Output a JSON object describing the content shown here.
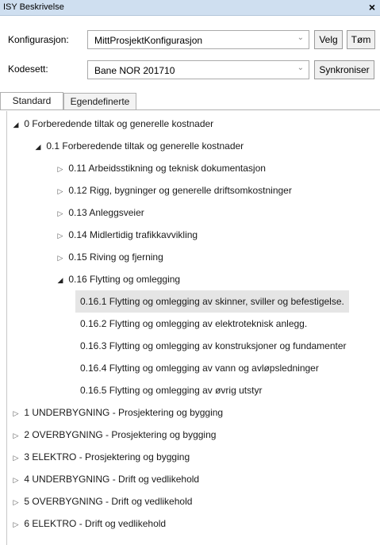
{
  "window": {
    "title": "ISY Beskrivelse",
    "close": "×"
  },
  "config": {
    "konfig_label": "Konfigurasjon:",
    "konfig_value": "MittProsjektKonfigurasjon",
    "velg": "Velg",
    "tom": "Tøm",
    "kodesett_label": "Kodesett:",
    "kodesett_value": "Bane NOR 201710",
    "synk": "Synkroniser"
  },
  "tabs": {
    "standard": "Standard",
    "egendefinerte": "Egendefinerte"
  },
  "icons": {
    "collapsed": "▷",
    "expanded": "◢",
    "dropdown": "⌄"
  },
  "tree": [
    {
      "text": "0 Forberedende tiltak og generelle kostnader",
      "expanded": true
    },
    {
      "text": "0.1  Forberedende tiltak og generelle kostnader",
      "expanded": true
    },
    {
      "text": "0.11  Arbeidsstikning og teknisk dokumentasjon",
      "expanded": false
    },
    {
      "text": "0.12  Rigg, bygninger og generelle driftsomkostninger",
      "expanded": false
    },
    {
      "text": "0.13  Anleggsveier",
      "expanded": false
    },
    {
      "text": "0.14  Midlertidig trafikkavvikling",
      "expanded": false
    },
    {
      "text": "0.15  Riving og fjerning",
      "expanded": false
    },
    {
      "text": "0.16  Flytting og omlegging",
      "expanded": true
    },
    {
      "text": "0.16.1  Flytting og omlegging av skinner, sviller og befestigelse.",
      "selected": true
    },
    {
      "text": "0.16.2  Flytting og omlegging av elektroteknisk anlegg."
    },
    {
      "text": "0.16.3  Flytting og omlegging av konstruksjoner og fundamenter"
    },
    {
      "text": "0.16.4  Flytting og omlegging av vann og avløpsledninger"
    },
    {
      "text": "0.16.5  Flytting og omlegging av øvrig utstyr"
    },
    {
      "text": "1 UNDERBYGNING - Prosjektering og bygging",
      "expanded": false
    },
    {
      "text": "2 OVERBYGNING - Prosjektering og bygging",
      "expanded": false
    },
    {
      "text": "3 ELEKTRO - Prosjektering og bygging",
      "expanded": false
    },
    {
      "text": "4 UNDERBYGNING - Drift og vedlikehold",
      "expanded": false
    },
    {
      "text": "5 OVERBYGNING - Drift og vedlikehold",
      "expanded": false
    },
    {
      "text": "6 ELEKTRO - Drift og vedlikehold",
      "expanded": false
    }
  ]
}
